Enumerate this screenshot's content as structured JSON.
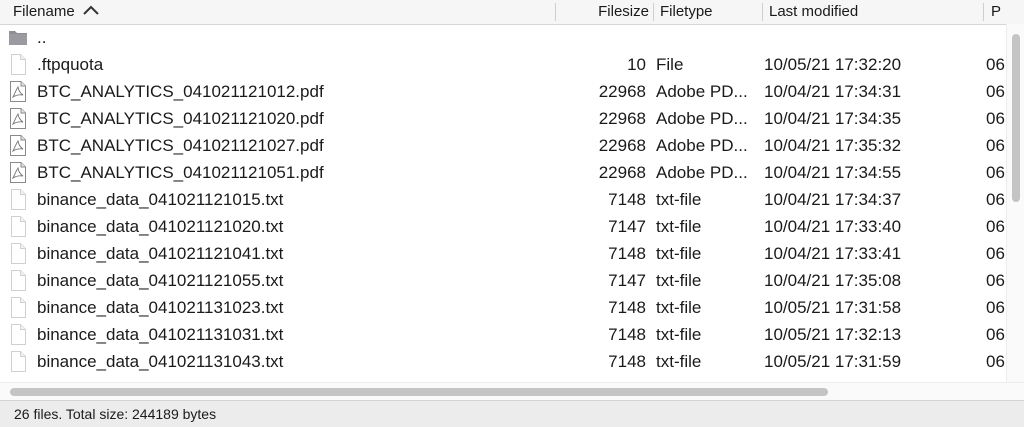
{
  "columns": {
    "filename": "Filename",
    "filesize": "Filesize",
    "filetype": "Filetype",
    "last_modified": "Last modified",
    "permissions": "P"
  },
  "sort": {
    "column": "filename",
    "direction": "ascending",
    "icon": "chevron-up-icon"
  },
  "files": [
    {
      "name": "..",
      "size": "",
      "type": "",
      "modified": "",
      "perm": "",
      "icon": "folder-icon"
    },
    {
      "name": ".ftpquota",
      "size": "10",
      "type": "File",
      "modified": "10/05/21 17:32:20",
      "perm": "06",
      "icon": "blank-file-icon"
    },
    {
      "name": "BTC_ANALYTICS_041021121012.pdf",
      "size": "22968",
      "type": "Adobe PD...",
      "modified": "10/04/21 17:34:31",
      "perm": "06",
      "icon": "pdf-file-icon"
    },
    {
      "name": "BTC_ANALYTICS_041021121020.pdf",
      "size": "22968",
      "type": "Adobe PD...",
      "modified": "10/04/21 17:34:35",
      "perm": "06",
      "icon": "pdf-file-icon"
    },
    {
      "name": "BTC_ANALYTICS_041021121027.pdf",
      "size": "22968",
      "type": "Adobe PD...",
      "modified": "10/04/21 17:35:32",
      "perm": "06",
      "icon": "pdf-file-icon"
    },
    {
      "name": "BTC_ANALYTICS_041021121051.pdf",
      "size": "22968",
      "type": "Adobe PD...",
      "modified": "10/04/21 17:34:55",
      "perm": "06",
      "icon": "pdf-file-icon"
    },
    {
      "name": "binance_data_041021121015.txt",
      "size": "7148",
      "type": "txt-file",
      "modified": "10/04/21 17:34:37",
      "perm": "06",
      "icon": "blank-file-icon"
    },
    {
      "name": "binance_data_041021121020.txt",
      "size": "7147",
      "type": "txt-file",
      "modified": "10/04/21 17:33:40",
      "perm": "06",
      "icon": "blank-file-icon"
    },
    {
      "name": "binance_data_041021121041.txt",
      "size": "7148",
      "type": "txt-file",
      "modified": "10/04/21 17:33:41",
      "perm": "06",
      "icon": "blank-file-icon"
    },
    {
      "name": "binance_data_041021121055.txt",
      "size": "7147",
      "type": "txt-file",
      "modified": "10/04/21 17:35:08",
      "perm": "06",
      "icon": "blank-file-icon"
    },
    {
      "name": "binance_data_041021131023.txt",
      "size": "7148",
      "type": "txt-file",
      "modified": "10/05/21 17:31:58",
      "perm": "06",
      "icon": "blank-file-icon"
    },
    {
      "name": "binance_data_041021131031.txt",
      "size": "7148",
      "type": "txt-file",
      "modified": "10/05/21 17:32:13",
      "perm": "06",
      "icon": "blank-file-icon"
    },
    {
      "name": "binance_data_041021131043.txt",
      "size": "7148",
      "type": "txt-file",
      "modified": "10/05/21 17:31:59",
      "perm": "06",
      "icon": "blank-file-icon"
    }
  ],
  "status_text": "26 files. Total size: 244189 bytes"
}
